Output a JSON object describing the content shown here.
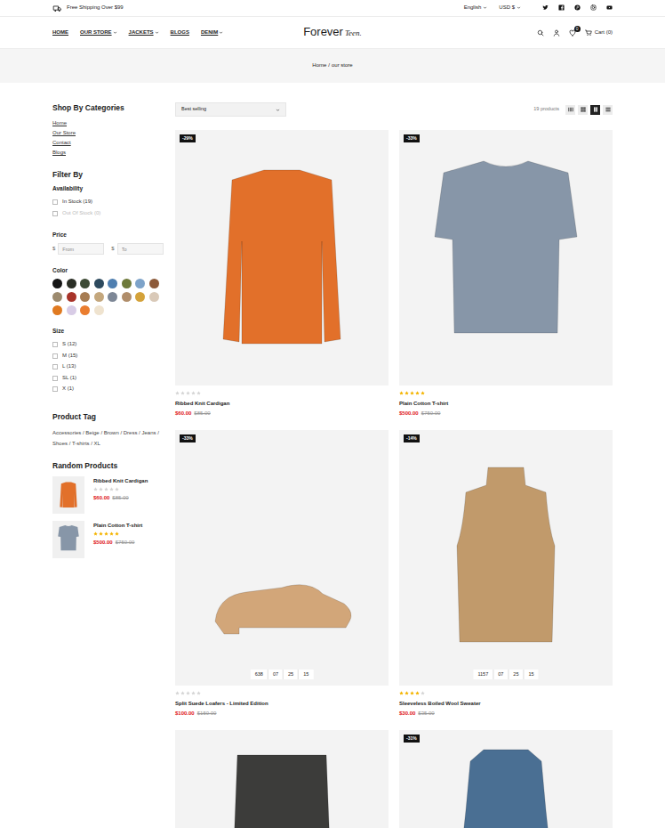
{
  "topbar": {
    "shipping": "Free Shipping Over $99",
    "language": "English",
    "currency": "USD $"
  },
  "nav": {
    "items": [
      {
        "label": "HOME",
        "dropdown": false
      },
      {
        "label": "OUR STORE",
        "dropdown": true
      },
      {
        "label": "JACKETS",
        "dropdown": true
      },
      {
        "label": "BLOGS",
        "dropdown": false
      },
      {
        "label": "DENIM",
        "dropdown": true
      }
    ],
    "logo": {
      "main": "Forever",
      "script": "Teen."
    },
    "wishlist_count": "0",
    "cart": "Cart (0)"
  },
  "breadcrumb": {
    "items": [
      "Home",
      "our store"
    ],
    "separator": "/"
  },
  "sidebar": {
    "categories": {
      "title": "Shop By Categories",
      "items": [
        "Home",
        "Our Store",
        "Contact",
        "Blogs"
      ]
    },
    "filter_title": "Filter By",
    "availability": {
      "title": "Availability",
      "options": [
        {
          "label": "In Stock (19)",
          "checked": false,
          "disabled": false
        },
        {
          "label": "Out Of Stock (0)",
          "checked": false,
          "disabled": true
        }
      ]
    },
    "price": {
      "title": "Price",
      "currency": "$",
      "from_placeholder": "From",
      "to_placeholder": "To"
    },
    "color": {
      "title": "Color",
      "swatches": [
        {
          "color": "#151515"
        },
        {
          "color": "#2b2f26"
        },
        {
          "color": "#3d4a35"
        },
        {
          "color": "#2d4a5e"
        },
        {
          "color": "#4f7fb0"
        },
        {
          "color": "#6e7a3a"
        },
        {
          "color": "#7ea3c9"
        },
        {
          "color": "#8c5a3a"
        },
        {
          "color": "#9c8a6e"
        },
        {
          "color": "#a8342a"
        },
        {
          "color": "#a67c52"
        },
        {
          "color": "#c4a77d"
        },
        {
          "color": "#7d8796"
        },
        {
          "color": "#b08d6a"
        },
        {
          "color": "#d4a23a"
        },
        {
          "color": "#d9c9b8"
        },
        {
          "color": "#e07a20"
        },
        {
          "color": "#d8cce6"
        },
        {
          "color": "#ea7d2f"
        },
        {
          "color": "#efe3cf"
        }
      ]
    },
    "size": {
      "title": "Size",
      "options": [
        {
          "label": "S (12)",
          "checked": false
        },
        {
          "label": "M (15)",
          "checked": false
        },
        {
          "label": "L (13)",
          "checked": false
        },
        {
          "label": "SL (1)",
          "checked": false
        },
        {
          "label": "X (1)",
          "checked": false
        }
      ]
    },
    "tags": {
      "title": "Product Tag",
      "separator": "/",
      "items": [
        "Accessories",
        "Beige",
        "Brown",
        "Dress",
        "Jeans",
        "Shoes",
        "T-shirts",
        "XL"
      ]
    },
    "random": {
      "title": "Random Products",
      "items": [
        {
          "name": "Ribbed Knit Cardigan",
          "stars": 0,
          "price": "$60.00",
          "old_price": "$85.00",
          "image": {
            "kind": "cardigan",
            "color": "#e2702a"
          }
        },
        {
          "name": "Plain Cotton T-shirt",
          "stars": 5,
          "price": "$500.00",
          "old_price": "$750.00",
          "image": {
            "kind": "tshirt",
            "color": "#8796a8"
          }
        }
      ]
    }
  },
  "toolbar": {
    "sort": "Best selling",
    "count": "19 products",
    "views": [
      {
        "kind": "grid4",
        "selected": false
      },
      {
        "kind": "grid3",
        "selected": false
      },
      {
        "kind": "grid2",
        "selected": true
      },
      {
        "kind": "list",
        "selected": false
      }
    ]
  },
  "products": [
    {
      "name": "Ribbed Knit Cardigan",
      "badge": "-29%",
      "stars": 0,
      "price": "$60.00",
      "old_price": "$85.00",
      "image": {
        "kind": "cardigan",
        "color": "#e2702a"
      }
    },
    {
      "name": "Plain Cotton T-shirt",
      "badge": "-33%",
      "stars": 5,
      "price": "$500.00",
      "old_price": "$750.00",
      "image": {
        "kind": "tshirt",
        "color": "#8796a8"
      }
    },
    {
      "name": "Split Suede Loafers - Limited Edition",
      "badge": "-33%",
      "stars": 0,
      "price": "$100.00",
      "old_price": "$150.00",
      "countdown": [
        "638",
        "07",
        "25",
        "15"
      ],
      "image": {
        "kind": "loafer",
        "color": "#d2a679"
      }
    },
    {
      "name": "Sleeveless Boiled Wool Sweater",
      "badge": "-14%",
      "stars": 4,
      "price": "$30.00",
      "old_price": "$35.00",
      "countdown": [
        "1157",
        "07",
        "25",
        "15"
      ],
      "image": {
        "kind": "sweater",
        "color": "#c19a6b"
      }
    },
    {
      "image": {
        "kind": "jeans",
        "color": "#3c3c3a"
      }
    },
    {
      "badge": "-31%",
      "image": {
        "kind": "dress",
        "color": "#4a6f93"
      }
    }
  ]
}
